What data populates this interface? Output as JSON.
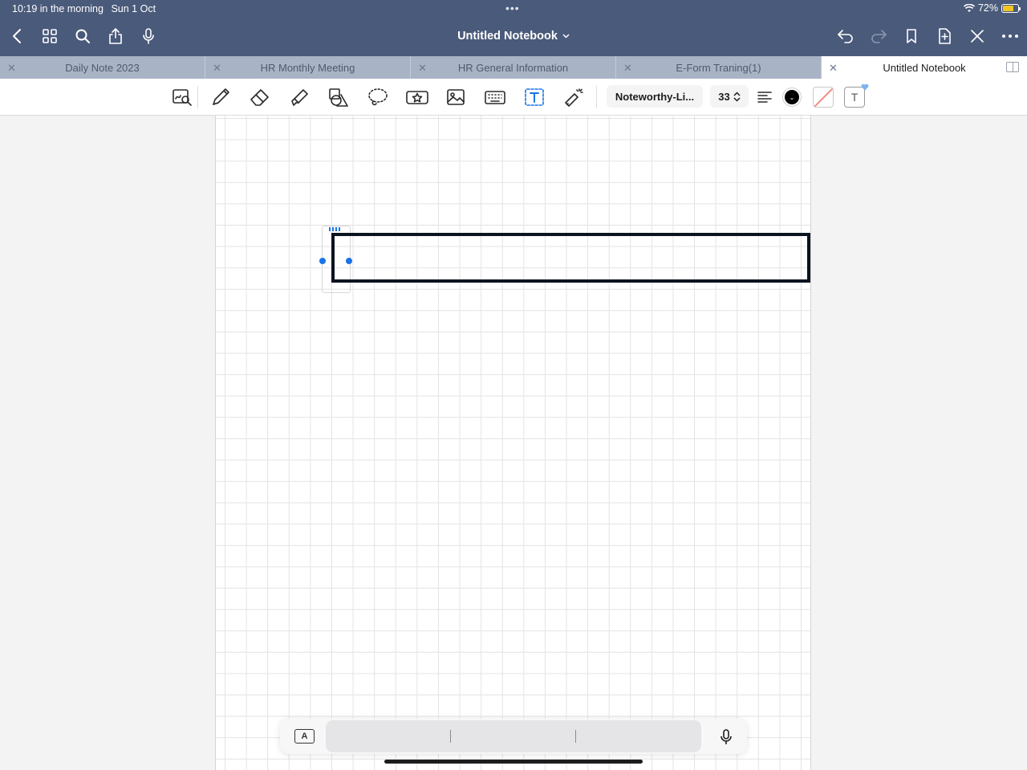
{
  "status_bar": {
    "time": "10:19 in the morning",
    "date": "Sun 1 Oct",
    "battery_percent": "72%",
    "battery_level": 0.72
  },
  "nav": {
    "notebook_title": "Untitled Notebook",
    "icons": [
      "back-icon",
      "grid-icon",
      "search-icon",
      "share-icon",
      "microphone-icon",
      "undo-icon",
      "redo-icon",
      "bookmark-icon",
      "add-page-icon",
      "close-icon",
      "more-icon"
    ]
  },
  "tabs": [
    {
      "label": "Daily Note 2023",
      "active": false
    },
    {
      "label": "HR Monthly Meeting",
      "active": false
    },
    {
      "label": "HR General Information",
      "active": false
    },
    {
      "label": "E-Form Traning(1)",
      "active": false
    },
    {
      "label": "Untitled Notebook",
      "active": true
    }
  ],
  "toolbar": {
    "tools": [
      "zoom-window",
      "pen",
      "eraser",
      "highlighter",
      "shapes",
      "lasso",
      "sticker",
      "image",
      "keyboard",
      "text",
      "laser-pointer"
    ],
    "selected_tool": "text",
    "font_name": "Noteworthy-Li...",
    "font_size": "33",
    "text_color": "#000000"
  },
  "keyboard_bar": {
    "format_key_label": "A"
  },
  "colors": {
    "nav_background": "#4a5a7a",
    "tab_background": "#a9b3c6",
    "accent": "#1a73e8"
  }
}
